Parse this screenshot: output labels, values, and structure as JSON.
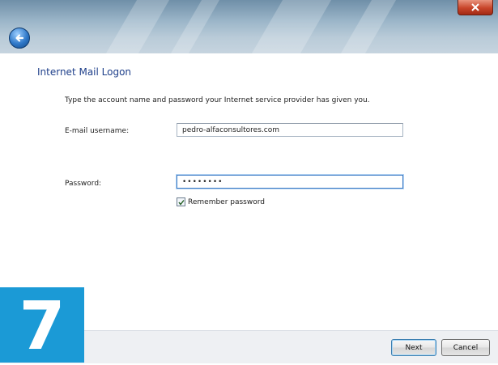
{
  "dialog": {
    "heading": "Internet Mail Logon",
    "instruction": "Type the account name and password your Internet service provider has given you."
  },
  "form": {
    "username_label": "E-mail username:",
    "username_value": "pedro-alfaconsultores.com",
    "password_label": "Password:",
    "password_value": "••••••••",
    "remember_label": "Remember password",
    "remember_checked": true
  },
  "buttons": {
    "next": "Next",
    "cancel": "Cancel"
  },
  "badge": {
    "step": "7"
  },
  "icons": {
    "back": "back-arrow-icon",
    "close": "close-icon",
    "check": "checkmark-icon"
  },
  "colors": {
    "heading": "#1e3f8a",
    "badge": "#1b9ad6",
    "close": "#c8452a"
  }
}
